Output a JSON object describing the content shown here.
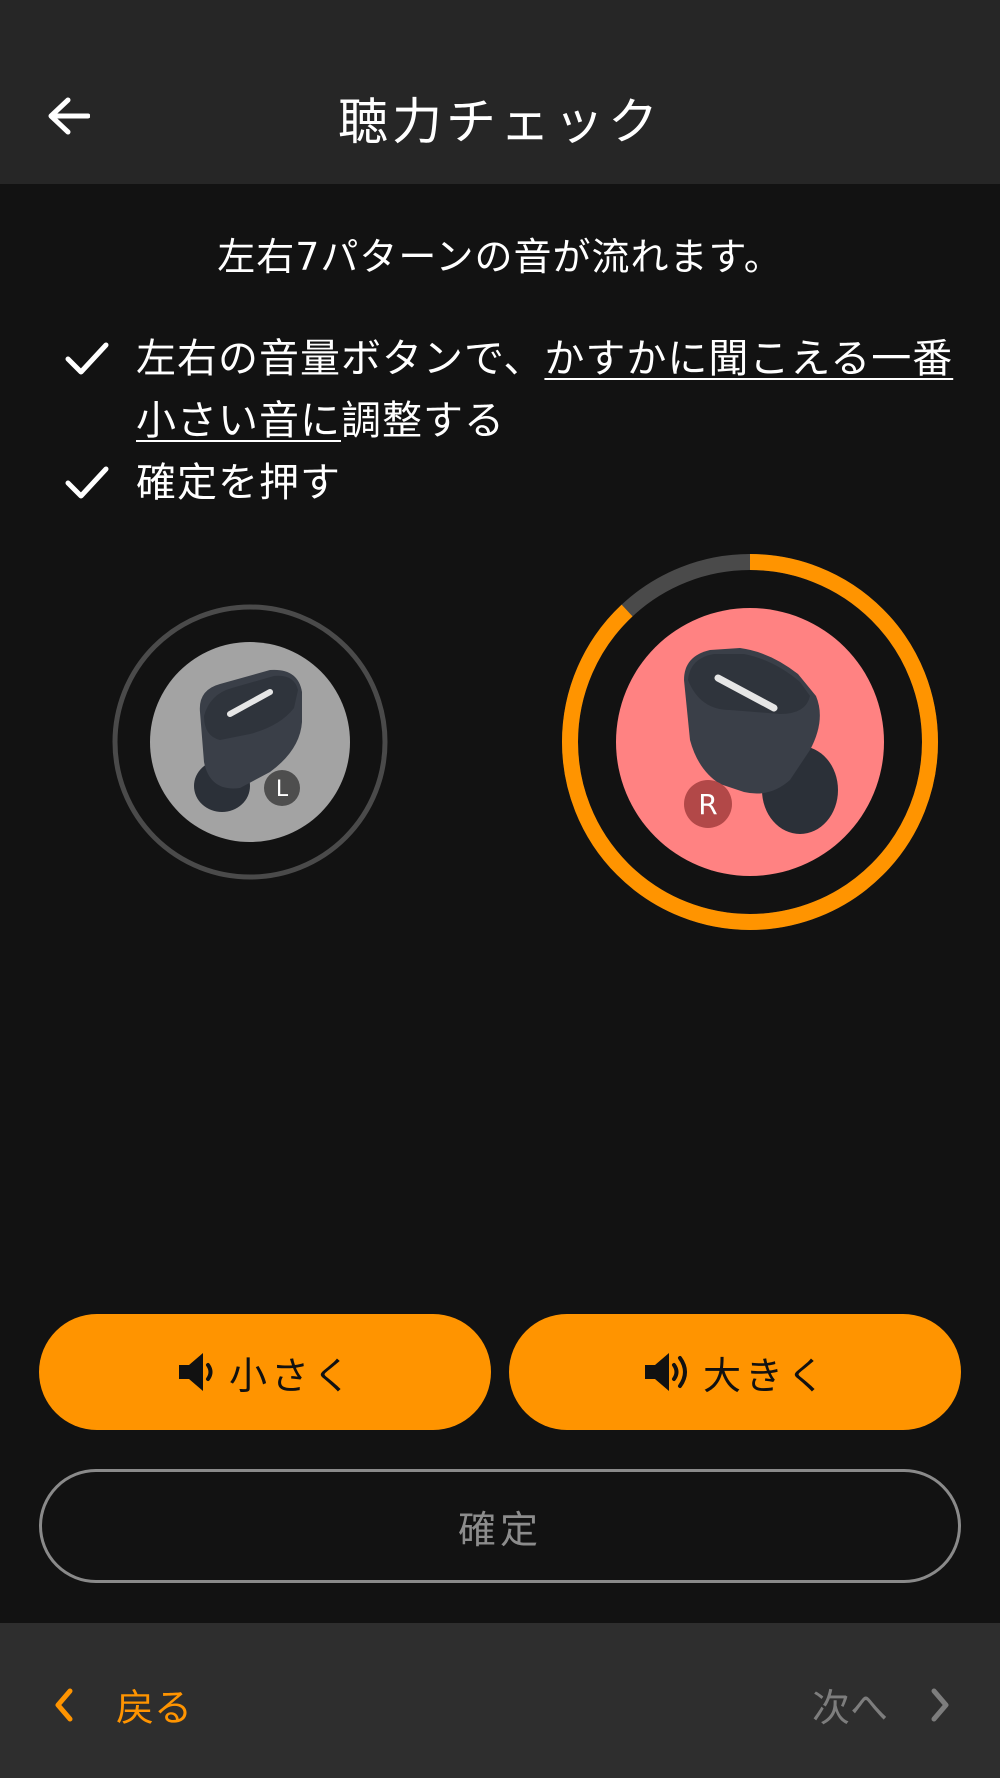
{
  "header": {
    "title": "聴力チェック"
  },
  "instructions": {
    "intro": "左右7パターンの音が流れます。",
    "step1_prefix": "左右の音量ボタンで、",
    "step1_underlined_a": "かすかに聞こえる一番",
    "step1_underlined_b": "小さい音に",
    "step1_suffix": "調整する",
    "step2": "確定を押す"
  },
  "earbuds": {
    "left": {
      "badge": "L",
      "active": false,
      "progress": 0
    },
    "right": {
      "badge": "R",
      "active": true,
      "progress": 0.88
    }
  },
  "controls": {
    "quieter_label": "小さく",
    "louder_label": "大きく",
    "confirm_label": "確定"
  },
  "footer": {
    "back_label": "戻る",
    "next_label": "次へ"
  },
  "colors": {
    "accent": "#ff9400",
    "active_bud_bg": "#ff8282",
    "inactive_bud_bg": "#a3a3a3",
    "track": "#4a4a4a"
  }
}
